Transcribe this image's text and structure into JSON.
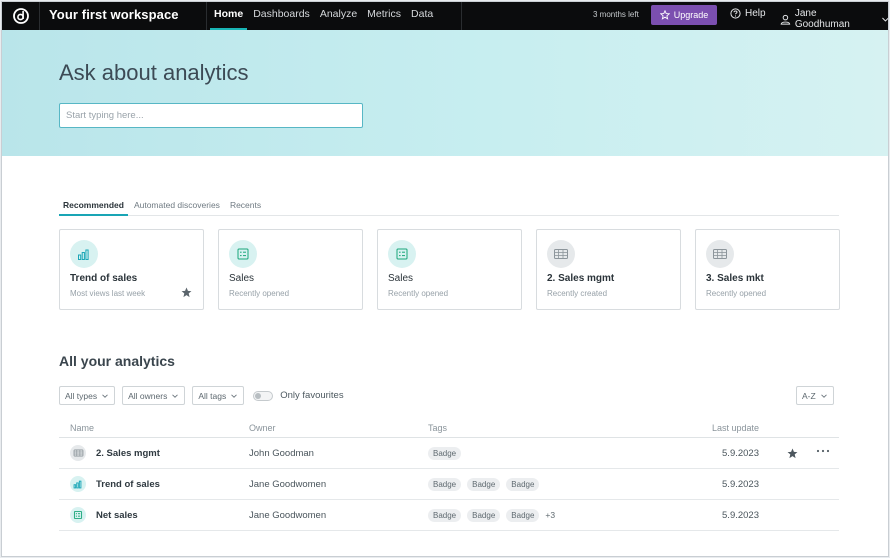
{
  "topbar": {
    "workspace_title": "Your first workspace",
    "nav": [
      "Home",
      "Dashboards",
      "Analyze",
      "Metrics",
      "Data"
    ],
    "active_nav": "Home",
    "trial_text": "3 months left",
    "upgrade_label": "Upgrade",
    "help_label": "Help",
    "user_name": "Jane Goodhuman"
  },
  "hero": {
    "title": "Ask about analytics",
    "search_placeholder": "Start typing here..."
  },
  "tabs": [
    "Recommended",
    "Automated discoveries",
    "Recents"
  ],
  "active_tab": "Recommended",
  "cards": [
    {
      "title": "Trend of sales",
      "subtitle": "Most views last week",
      "icon": "bar-chart-icon",
      "starred": true
    },
    {
      "title": "Sales",
      "subtitle": "Recently opened",
      "icon": "dashboard-icon",
      "starred": false
    },
    {
      "title": "Sales",
      "subtitle": "Recently opened",
      "icon": "dashboard-icon",
      "starred": false
    },
    {
      "title": "2. Sales mgmt",
      "subtitle": "Recently created",
      "icon": "table-icon",
      "starred": false
    },
    {
      "title": "3. Sales mkt",
      "subtitle": "Recently opened",
      "icon": "table-icon",
      "starred": false
    }
  ],
  "analytics": {
    "title": "All your analytics",
    "filters": [
      "All types",
      "All owners",
      "All tags"
    ],
    "favourites_label": "Only favourites",
    "sort_label": "A-Z",
    "columns": {
      "name": "Name",
      "owner": "Owner",
      "tags": "Tags",
      "last_update": "Last update"
    },
    "rows": [
      {
        "name": "2. Sales mgmt",
        "owner": "John Goodman",
        "tags": [
          "Badge"
        ],
        "more_tags": "",
        "last_update": "5.9.2023",
        "icon": "table-icon",
        "starred": true
      },
      {
        "name": "Trend of sales",
        "owner": "Jane Goodwomen",
        "tags": [
          "Badge",
          "Badge",
          "Badge"
        ],
        "more_tags": "",
        "last_update": "5.9.2023",
        "icon": "bar-chart-icon",
        "starred": false
      },
      {
        "name": "Net sales",
        "owner": "Jane Goodwomen",
        "tags": [
          "Badge",
          "Badge",
          "Badge"
        ],
        "more_tags": "+3",
        "last_update": "5.9.2023",
        "icon": "dashboard-icon",
        "starred": false
      }
    ]
  },
  "colors": {
    "accent": "#19b5b5",
    "upgrade": "#7b4fb0",
    "topbar": "#0b0c0d"
  }
}
